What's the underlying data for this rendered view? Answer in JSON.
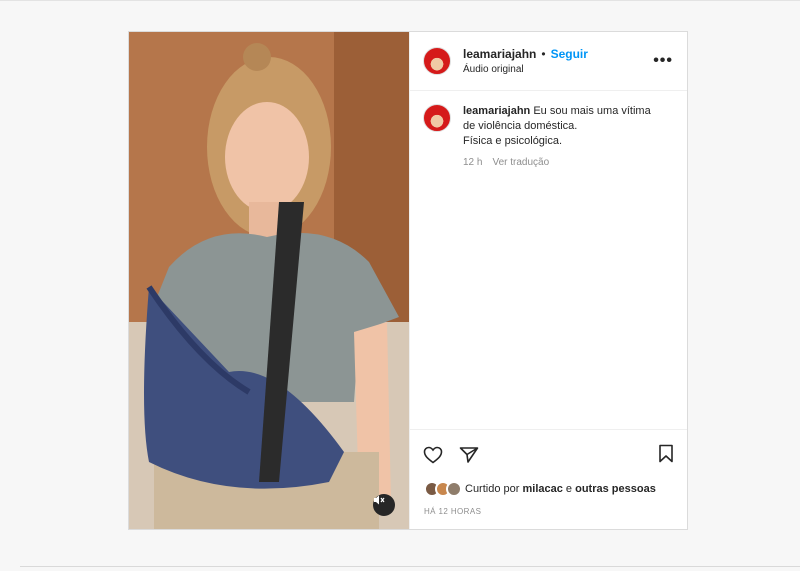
{
  "post": {
    "username": "leamariajahn",
    "separator": "•",
    "follow_label": "Seguir",
    "audio_label": "Áudio original",
    "more_label": "•••"
  },
  "caption": {
    "username": "leamariajahn",
    "line1": "Eu sou mais uma vítima de violência doméstica.",
    "line2": "Física e psicológica.",
    "time": "12 h",
    "translate_label": "Ver tradução"
  },
  "likes": {
    "prefix": "Curtido por",
    "user": "milacac",
    "connector": "e",
    "others": "outras pessoas"
  },
  "timestamp": "HÁ 12 HORAS",
  "colors": {
    "accent": "#0095f6",
    "text": "#262626",
    "muted": "#8e8e8e",
    "avatar_red": "#d51a1a"
  },
  "icons": [
    "heart-icon",
    "share-icon",
    "bookmark-icon",
    "mute-icon",
    "more-icon"
  ]
}
